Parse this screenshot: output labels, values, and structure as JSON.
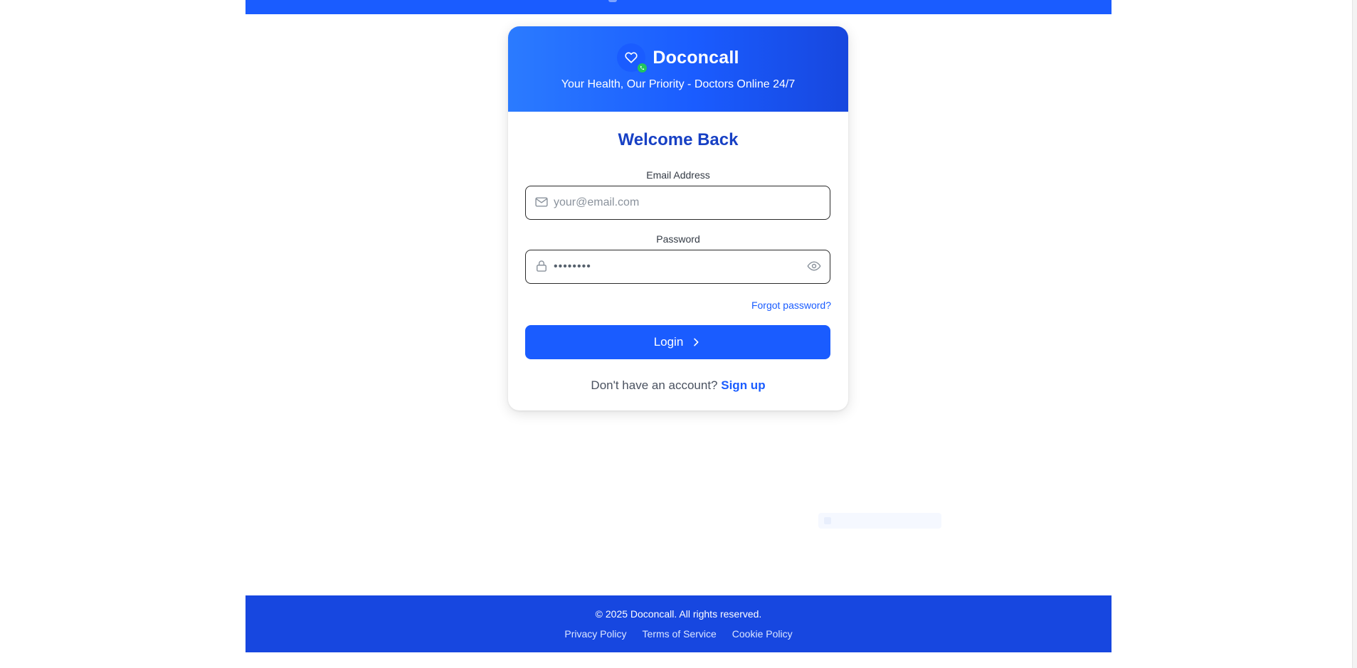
{
  "app": {
    "brand": "Doconcall",
    "tagline": "Your Health, Our Priority - Doctors Online 24/7",
    "icons": {
      "logo": "heart-icon",
      "logo_badge": "phone-icon"
    },
    "colors": {
      "primary": "#1a5cff",
      "heading": "#1740c4",
      "footer_bg": "#1747e0",
      "badge": "#22c55e"
    }
  },
  "login_form": {
    "title": "Welcome Back",
    "email": {
      "label": "Email Address",
      "placeholder": "your@email.com",
      "value": "",
      "icon": "mail-icon"
    },
    "password": {
      "label": "Password",
      "value": "••••••••",
      "icon": "lock-icon",
      "toggle_icon": "eye-icon"
    },
    "forgot_label": "Forgot password?",
    "submit_label": "Login",
    "submit_icon": "chevron-right-icon",
    "signup_prompt": "Don't have an account?",
    "signup_label": "Sign up"
  },
  "footer": {
    "copyright": "© 2025 Doconcall. All rights reserved.",
    "links": [
      "Privacy Policy",
      "Terms of Service",
      "Cookie Policy"
    ]
  }
}
